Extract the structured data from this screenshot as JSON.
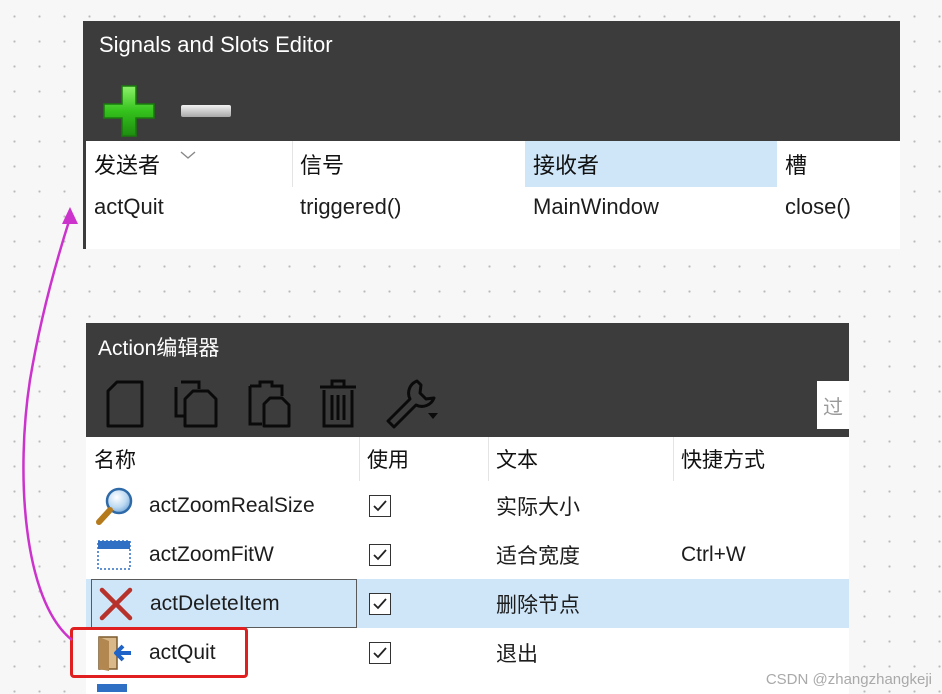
{
  "signals_panel": {
    "title": "Signals and Slots Editor",
    "toolbar": {
      "add_icon": "plus-icon",
      "remove_icon": "minus-icon"
    },
    "columns": [
      "发送者",
      "信号",
      "接收者",
      "槽"
    ],
    "rows": [
      {
        "sender": "actQuit",
        "signal": "triggered()",
        "receiver": "MainWindow",
        "slot": "close()"
      }
    ]
  },
  "action_panel": {
    "title": "Action编辑器",
    "toolbar": {
      "filter_placeholder": "过"
    },
    "columns": [
      "名称",
      "使用",
      "文本",
      "快捷方式"
    ],
    "rows": [
      {
        "name": "actZoomRealSize",
        "icon": "magnifier-icon",
        "text": "实际大小",
        "shortcut": ""
      },
      {
        "name": "actZoomFitW",
        "icon": "fit-width-icon",
        "text": "适合宽度",
        "shortcut": "Ctrl+W"
      },
      {
        "name": "actDeleteItem",
        "icon": "delete-x-icon",
        "text": "删除节点",
        "shortcut": ""
      },
      {
        "name": "actQuit",
        "icon": "exit-door-icon",
        "text": "退出",
        "shortcut": ""
      }
    ]
  },
  "annotation": {
    "highlight_color": "#e02020",
    "arrow_color": "#cc33cc"
  },
  "watermark": "CSDN @zhangzhangkeji"
}
